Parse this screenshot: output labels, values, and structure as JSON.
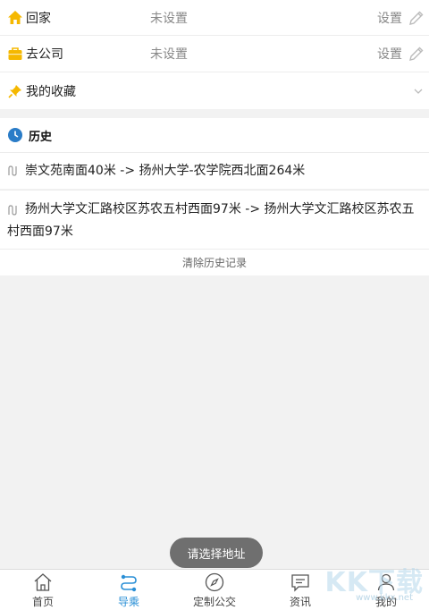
{
  "places": {
    "home": {
      "label": "回家",
      "status": "未设置",
      "action": "设置"
    },
    "work": {
      "label": "去公司",
      "status": "未设置",
      "action": "设置"
    },
    "favorites": {
      "label": "我的收藏"
    }
  },
  "history": {
    "title": "历史",
    "items": [
      {
        "text": "崇文苑南面40米 -> 扬州大学-农学院西北面264米"
      },
      {
        "text": "扬州大学文汇路校区苏农五村西面97米 -> 扬州大学文汇路校区苏农五村西面97米"
      }
    ],
    "clear_label": "清除历史记录"
  },
  "toast": "请选择地址",
  "tabs": [
    {
      "label": "首页",
      "icon": "home-icon",
      "active": false
    },
    {
      "label": "导乘",
      "icon": "route-guide-icon",
      "active": true
    },
    {
      "label": "定制公交",
      "icon": "compass-icon",
      "active": false
    },
    {
      "label": "资讯",
      "icon": "message-icon",
      "active": false
    },
    {
      "label": "我的",
      "icon": "user-icon",
      "active": false
    }
  ],
  "watermark": {
    "brand": "KK下载",
    "url": "www.kkx.net"
  },
  "colors": {
    "accent": "#2a8fd6",
    "icon_yellow": "#f5b800",
    "background": "#f2f2f2"
  }
}
